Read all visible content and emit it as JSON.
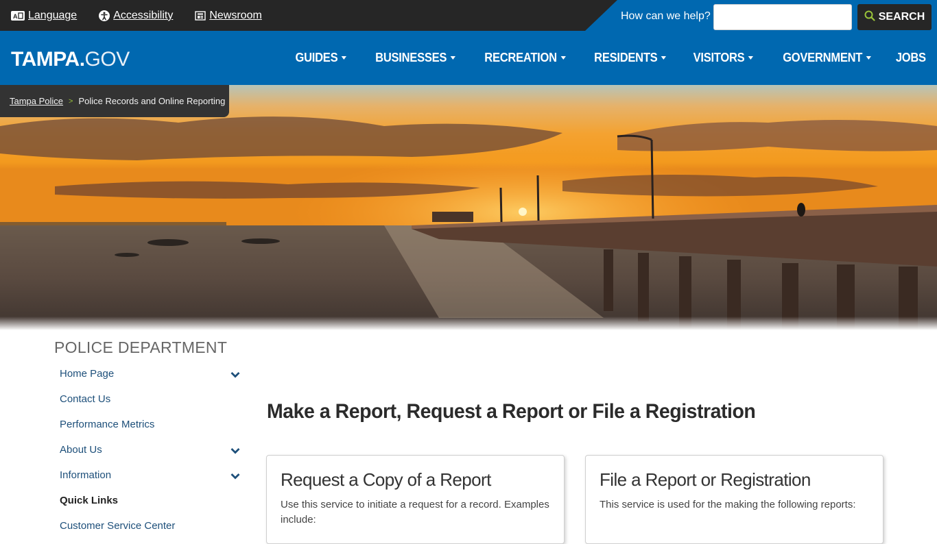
{
  "utility": {
    "links": [
      {
        "label": "Language",
        "icon": "language-icon"
      },
      {
        "label": "Accessibility",
        "icon": "accessibility-icon"
      },
      {
        "label": "Newsroom",
        "icon": "newsroom-icon"
      }
    ],
    "help_label": "How can we help?",
    "search_value": "",
    "search_placeholder": "",
    "search_button": "SEARCH"
  },
  "nav": {
    "logo_bold": "TAMPA.",
    "logo_thin": "GOV",
    "items": [
      {
        "label": "GUIDES",
        "dropdown": true
      },
      {
        "label": "BUSINESSES",
        "dropdown": true
      },
      {
        "label": "RECREATION",
        "dropdown": true
      },
      {
        "label": "RESIDENTS",
        "dropdown": true
      },
      {
        "label": "VISITORS",
        "dropdown": true
      },
      {
        "label": "GOVERNMENT",
        "dropdown": true
      },
      {
        "label": "JOBS",
        "dropdown": false
      }
    ]
  },
  "breadcrumb": {
    "parent": "Tampa Police",
    "separator": ">",
    "current": "Police Records and Online Reporting"
  },
  "sidebar": {
    "title": "POLICE DEPARTMENT",
    "items": [
      {
        "label": "Home Page",
        "expandable": true
      },
      {
        "label": "Contact Us",
        "expandable": false
      },
      {
        "label": "Performance Metrics",
        "expandable": false
      },
      {
        "label": "About Us",
        "expandable": true
      },
      {
        "label": "Information",
        "expandable": true
      },
      {
        "label": "Quick Links",
        "heading": true
      },
      {
        "label": "Customer Service Center",
        "expandable": false
      }
    ]
  },
  "main": {
    "title": "Make a Report, Request a Report or File a Registration",
    "cards": [
      {
        "title": "Request a Copy of a Report",
        "text": "Use this service to initiate a request for a record. Examples include:"
      },
      {
        "title": "File a Report or Registration",
        "text": "This service is used for the making the following reports:"
      }
    ]
  },
  "colors": {
    "brand_blue": "#0068b0",
    "dark": "#262626",
    "accent_green": "#9ac43a",
    "link_blue": "#1d4f7a"
  }
}
